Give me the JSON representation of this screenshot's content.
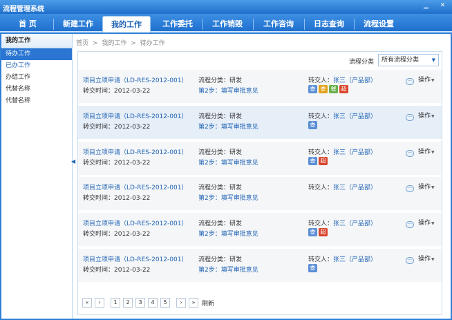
{
  "window": {
    "title": "流程管理系统"
  },
  "menu": {
    "tabs": [
      {
        "label": "首 页"
      },
      {
        "label": "新建工作"
      },
      {
        "label": "我的工作"
      },
      {
        "label": "工作委托"
      },
      {
        "label": "工作销毁"
      },
      {
        "label": "工作咨询"
      },
      {
        "label": "日志查询"
      },
      {
        "label": "流程设置"
      }
    ],
    "active_index": 2
  },
  "sidebar": {
    "title": "我的工作",
    "items": [
      {
        "label": "待办工作"
      },
      {
        "label": "已办工作"
      },
      {
        "label": "办结工作"
      },
      {
        "label": "代替名称"
      },
      {
        "label": "代替名称"
      }
    ]
  },
  "breadcrumb": [
    "首页",
    ">",
    "我的工作",
    ">",
    "待办工作"
  ],
  "filter": {
    "label": "流程分类",
    "selected": "所有流程分类"
  },
  "rows": [
    {
      "title": "项目立项申请（LD-RES-2012-001）",
      "time_label": "转交时间：",
      "time": "2012-03-22",
      "category": "流程分类：研发",
      "step": "第2步：填写审批意见",
      "transfer_label": "转交人：",
      "transfer_person": "张三（产品部）",
      "badges": [
        {
          "text": "委",
          "color": "#5b8fd6"
        },
        {
          "text": "委",
          "color": "#e3a21a"
        },
        {
          "text": "催",
          "color": "#6ab04c"
        },
        {
          "text": "超",
          "color": "#d9462e"
        }
      ],
      "op": "操作"
    },
    {
      "title": "项目立项申请（LD-RES-2012-001）",
      "time_label": "转交时间：",
      "time": "2012-03-22",
      "category": "流程分类：研发",
      "step": "第2步：填写审批意见",
      "transfer_label": "转交人：",
      "transfer_person": "张三（产品部）",
      "badges": [
        {
          "text": "委",
          "color": "#5b8fd6"
        }
      ],
      "op": "操作"
    },
    {
      "title": "项目立项申请（LD-RES-2012-001）",
      "time_label": "转交时间：",
      "time": "2012-03-22",
      "category": "流程分类：研发",
      "step": "第2步：填写审批意见",
      "transfer_label": "转交人：",
      "transfer_person": "张三（产品部）",
      "badges": [
        {
          "text": "委",
          "color": "#5b8fd6"
        },
        {
          "text": "超",
          "color": "#d9462e"
        }
      ],
      "op": "操作"
    },
    {
      "title": "项目立项申请（LD-RES-2012-001）",
      "time_label": "转交时间：",
      "time": "2012-03-22",
      "category": "流程分类：研发",
      "step": "第2步：填写审批意见",
      "transfer_label": "转交人：",
      "transfer_person": "张三（产品部）",
      "badges": [],
      "op": "操作"
    },
    {
      "title": "项目立项申请（LD-RES-2012-001）",
      "time_label": "转交时间：",
      "time": "2012-03-22",
      "category": "流程分类：研发",
      "step": "第2步：填写审批意见",
      "transfer_label": "转交人：",
      "transfer_person": "张三（产品部）",
      "badges": [
        {
          "text": "委",
          "color": "#5b8fd6"
        },
        {
          "text": "超",
          "color": "#d9462e"
        }
      ],
      "op": "操作"
    },
    {
      "title": "项目立项申请（LD-RES-2012-001）",
      "time_label": "转交时间：",
      "time": "2012-03-22",
      "category": "流程分类：研发",
      "step": "第2步：填写审批意见",
      "transfer_label": "转交人：",
      "transfer_person": "张三（产品部）",
      "badges": [
        {
          "text": "委",
          "color": "#5b8fd6"
        }
      ],
      "op": "操作"
    }
  ],
  "pager": {
    "first": "«",
    "prev": "‹",
    "pages": [
      "1",
      "2",
      "3",
      "4",
      "5"
    ],
    "next": "›",
    "last": "»",
    "refresh": "刷新"
  },
  "icons": {
    "minimize": "minimize-icon",
    "close": "close-icon",
    "comment": "comment-icon"
  },
  "colors": {
    "accent": "#2e7fd8",
    "link": "#1f63b4",
    "row_highlight": "#e6eef8"
  }
}
